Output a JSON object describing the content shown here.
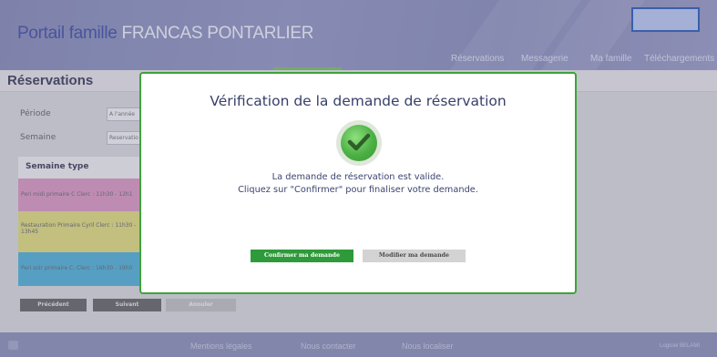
{
  "header": {
    "brand_primary": "Portail famille",
    "brand_secondary": "FRANCAS PONTARLIER",
    "nav": [
      "Réservations",
      "Messagerie",
      "Ma famille",
      "Téléchargements"
    ]
  },
  "page": {
    "title": "Réservations"
  },
  "form": {
    "periode_label": "Période",
    "periode_value": "A l'année",
    "semaine_label": "Semaine",
    "semaine_value": "Reservatio"
  },
  "week": {
    "header": "Semaine type",
    "slots": [
      {
        "label": "Peri midi primaire C Clerc : 11h30 - 12h1",
        "color": "#d39ac1"
      },
      {
        "label": "Restauration Primaire Cyril Clerc : 11h30 - 13h45",
        "color": "#d8d487"
      },
      {
        "label": "Peri soir primaire C. Clerc : 16h30 - 19h0",
        "color": "#5db0d4"
      }
    ]
  },
  "bottom_buttons": {
    "previous": "Précédent",
    "next": "Suivant",
    "cancel": "Annuler"
  },
  "footer": {
    "links": [
      "Mentions légales",
      "Nous contacter",
      "Nous localiser"
    ],
    "right": "Logiciel BELAMI"
  },
  "modal": {
    "title": "Vérification de la demande de réservation",
    "status_icon": "check-circle-icon",
    "message_line1": "La demande de réservation est valide.",
    "message_line2": "Cliquez sur \"Confirmer\" pour finaliser votre demande.",
    "confirm_label": "Confirmer ma demande",
    "modify_label": "Modifier ma demande",
    "accent_color": "#3ea33a"
  }
}
